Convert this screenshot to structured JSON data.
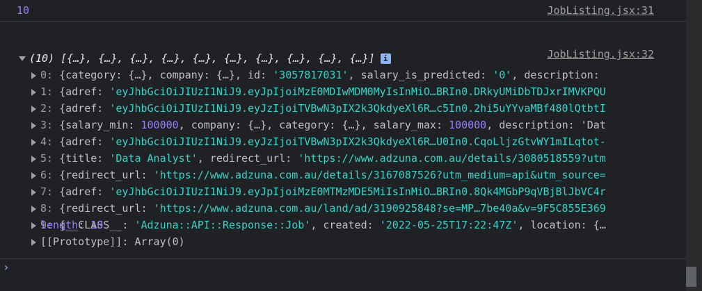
{
  "row1": {
    "value": "10",
    "source": "JobListing.jsx:31"
  },
  "row2": {
    "source": "JobListing.jsx:32",
    "array_summary": "(10) [{…}, {…}, {…}, {…}, {…}, {…}, {…}, {…}, {…}, {…}]",
    "info_badge": "i",
    "items": [
      {
        "index": "0:",
        "parts": [
          "{category: {…}, company: {…}, id: ",
          "'3057817031'",
          ", salary_is_predicted: ",
          "'0'",
          ", description:"
        ]
      },
      {
        "index": "1:",
        "parts": [
          "{adref: ",
          "'eyJhbGciOiJIUzI1NiJ9.eyJpIjoiMzE0MDIwMDM0MyIsInMiO…BRIn0.DRkyUMiDbTDJxrIMVKPQU",
          "",
          "",
          ""
        ]
      },
      {
        "index": "2:",
        "parts": [
          "{adref: ",
          "'eyJhbGciOiJIUzI1NiJ9.eyJzIjoiTVBwN3pIX2k3QkdyeXl6R…c5In0.2hi5uYYvaMBf480lQtbtI",
          "",
          "",
          ""
        ]
      },
      {
        "index": "3:",
        "parts": [
          "{salary_min: ",
          "100000",
          ", company: {…}, category: {…}, salary_max: ",
          "100000",
          ", description: 'Dat"
        ]
      },
      {
        "index": "4:",
        "parts": [
          "{adref: ",
          "'eyJhbGciOiJIUzI1NiJ9.eyJzIjoiTVBwN3pIX2k3QkdyeXl6R…U0In0.CqoLljzGtvWY1mILqtot-",
          "",
          "",
          ""
        ]
      },
      {
        "index": "5:",
        "parts": [
          "{title: ",
          "'Data Analyst'",
          ", redirect_url: ",
          "'https://www.adzuna.com.au/details/3080518559?utm",
          ""
        ]
      },
      {
        "index": "6:",
        "parts": [
          "{redirect_url: ",
          "'https://www.adzuna.com.au/details/3167087526?utm_medium=api&utm_source=",
          "",
          "",
          ""
        ]
      },
      {
        "index": "7:",
        "parts": [
          "{adref: ",
          "'eyJhbGciOiJIUzI1NiJ9.eyJpIjoiMzE0MTMzMDE5MiIsInMiO…BRIn0.8Qk4MGbP9qVBjBlJbVC4r",
          "",
          "",
          ""
        ]
      },
      {
        "index": "8:",
        "parts": [
          "{redirect_url: ",
          "'https://www.adzuna.com.au/land/ad/3190925848?se=MP…7be40a&v=9F5C855E369",
          "",
          "",
          ""
        ]
      },
      {
        "index": "9:",
        "parts": [
          "{__CLASS__: ",
          "'Adzuna::API::Response::Job'",
          ", created: ",
          "'2022-05-25T17:22:47Z'",
          ", location: {…"
        ]
      }
    ],
    "length_key": "length",
    "length_sep": ": ",
    "length_value": "10",
    "prototype": "[[Prototype]]: Array(0)"
  },
  "prompt": "›"
}
